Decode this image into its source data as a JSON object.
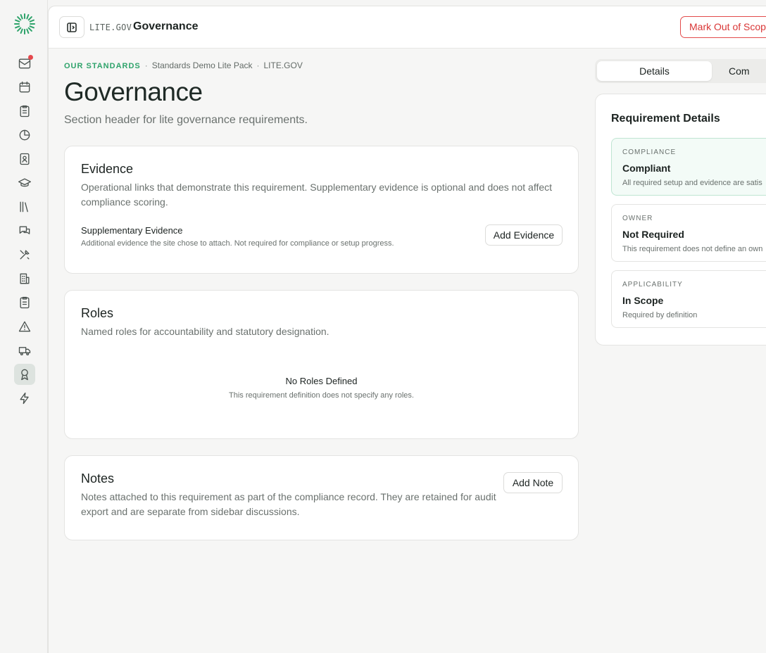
{
  "colors": {
    "accent_green": "#2fa36b",
    "danger_red": "#d93636",
    "notification_dot": "#e5484d"
  },
  "rail": {
    "items": [
      {
        "icon": "inbox-icon",
        "has_notification": true
      },
      {
        "icon": "calendar-icon"
      },
      {
        "icon": "clipboard-list-icon"
      },
      {
        "icon": "pie-chart-icon"
      },
      {
        "icon": "contact-book-icon"
      },
      {
        "icon": "graduation-cap-icon"
      },
      {
        "icon": "library-icon"
      },
      {
        "icon": "messages-icon"
      },
      {
        "icon": "tools-icon"
      },
      {
        "icon": "building-icon"
      },
      {
        "icon": "clipboard-check-icon"
      },
      {
        "icon": "warning-icon"
      },
      {
        "icon": "truck-icon"
      },
      {
        "icon": "award-icon",
        "active": true
      },
      {
        "icon": "lightning-icon"
      }
    ]
  },
  "topbar": {
    "code": "LITE.GOV",
    "title": "Governance",
    "mark_out_of_scope_label": "Mark Out of Scope"
  },
  "breadcrumb": {
    "items": [
      "OUR STANDARDS",
      "Standards Demo Lite Pack",
      "LITE.GOV"
    ],
    "separator": "·"
  },
  "header": {
    "title": "Governance",
    "subtitle": "Section header for lite governance requirements."
  },
  "evidence": {
    "title": "Evidence",
    "description": "Operational links that demonstrate this requirement. Supplementary evidence is optional and does not affect compliance scoring.",
    "supplementary_title": "Supplementary Evidence",
    "supplementary_description": "Additional evidence the site chose to attach. Not required for compliance or setup progress.",
    "add_button": "Add Evidence"
  },
  "roles": {
    "title": "Roles",
    "description": "Named roles for accountability and statutory designation.",
    "empty_title": "No Roles Defined",
    "empty_description": "This requirement definition does not specify any roles."
  },
  "notes": {
    "title": "Notes",
    "description": "Notes attached to this requirement as part of the compliance record. They are retained for audit export and are separate from sidebar discussions.",
    "add_button": "Add Note"
  },
  "tabs": {
    "details": "Details",
    "other": "Com"
  },
  "requirement_details": {
    "title": "Requirement Details",
    "compliance": {
      "label": "COMPLIANCE",
      "value": "Compliant",
      "note": "All required setup and evidence are satis"
    },
    "owner": {
      "label": "OWNER",
      "value": "Not Required",
      "note": "This requirement does not define an own"
    },
    "applicability": {
      "label": "APPLICABILITY",
      "value": "In Scope",
      "note": "Required by definition"
    }
  }
}
